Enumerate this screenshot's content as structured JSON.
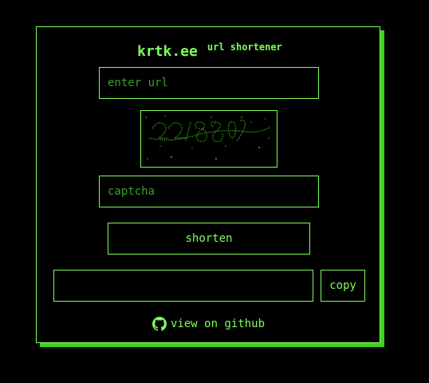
{
  "header": {
    "brand": "krtk.ee",
    "tagline": "url shortener"
  },
  "form": {
    "url_placeholder": "enter url",
    "captcha_placeholder": "captcha",
    "captcha_image_alt": "captcha image",
    "shorten_label": "shorten",
    "result_value": "",
    "copy_label": "copy"
  },
  "footer": {
    "github_label": "view on github",
    "github_icon": "github-icon"
  },
  "colors": {
    "background": "#000000",
    "accent": "#7dff5a",
    "shadow": "#3fd120",
    "captcha_ink": "#2f8a1c"
  }
}
